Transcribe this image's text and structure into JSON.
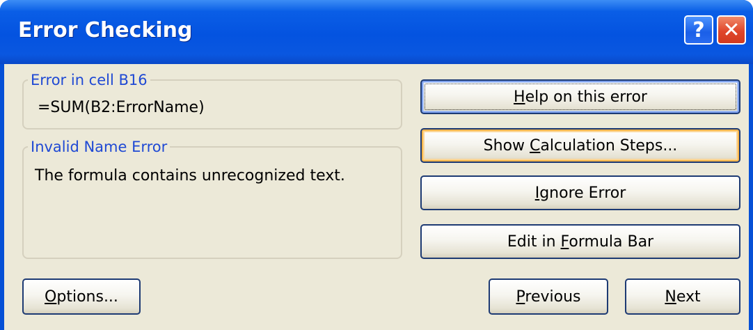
{
  "window": {
    "title": "Error Checking",
    "help_icon": "question-mark-icon",
    "close_icon": "close-x-icon",
    "help_glyph": "?",
    "close_glyph": "✕"
  },
  "error_group": {
    "legend": "Error in cell B16",
    "formula": "=SUM(B2:ErrorName)"
  },
  "description_group": {
    "legend": "Invalid Name Error",
    "text": "The formula contains unrecognized text."
  },
  "buttons": {
    "help_error": {
      "pre": "",
      "key": "H",
      "post": "elp on this error"
    },
    "show_steps": {
      "pre": "Show ",
      "key": "C",
      "post": "alculation Steps..."
    },
    "ignore": {
      "pre": "",
      "key": "I",
      "post": "gnore Error"
    },
    "edit_formula": {
      "pre": "Edit in ",
      "key": "F",
      "post": "ormula Bar"
    },
    "options": {
      "pre": "",
      "key": "O",
      "post": "ptions..."
    },
    "previous": {
      "pre": "",
      "key": "P",
      "post": "revious"
    },
    "next": {
      "pre": "",
      "key": "N",
      "post": "ext"
    }
  },
  "colors": {
    "titlebar": "#0453e0",
    "dialog_face": "#ece9d8",
    "group_label": "#1f49d4",
    "close_button": "#e0462b"
  }
}
